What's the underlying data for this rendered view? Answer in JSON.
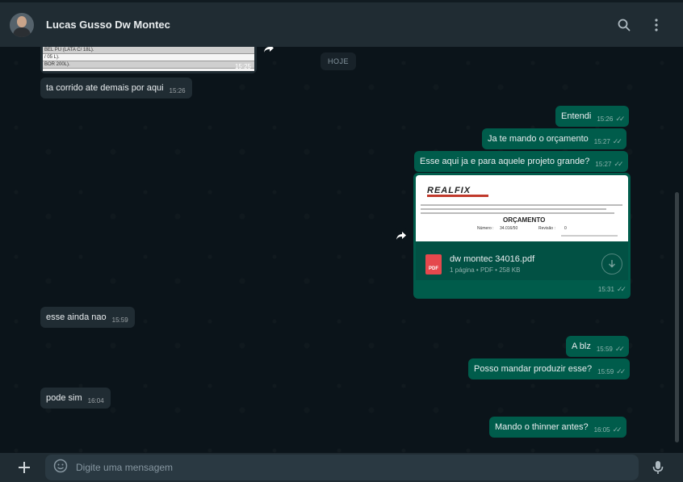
{
  "header": {
    "contact_name": "Lucas Gusso Dw Montec",
    "search_icon": "search-icon",
    "menu_icon": "kebab-menu-icon"
  },
  "chat": {
    "day_chip": "HOJE",
    "image_fragment": {
      "rows": [
        "BEL PU (LATA C/ 18L).",
        "/ 05 L).",
        "BOR 200L)."
      ],
      "time": "15:25"
    },
    "messages": [
      {
        "id": "m1",
        "direction": "in",
        "text": "ta corrido ate demais por aqui",
        "time": "15:26"
      },
      {
        "id": "m2",
        "direction": "out",
        "text": "Entendi",
        "time": "15:26"
      },
      {
        "id": "m3",
        "direction": "out",
        "text": "Ja te mando o orçamento",
        "time": "15:27"
      },
      {
        "id": "m4",
        "direction": "out",
        "text": "Esse aqui ja e para aquele projeto grande?",
        "time": "15:27"
      },
      {
        "id": "m6",
        "direction": "in",
        "text": "esse ainda nao",
        "time": "15:59"
      },
      {
        "id": "m7",
        "direction": "out",
        "text": "A blz",
        "time": "15:59"
      },
      {
        "id": "m8",
        "direction": "out",
        "text": "Posso mandar produzir esse?",
        "time": "15:59"
      },
      {
        "id": "m9",
        "direction": "in",
        "text": "pode sim",
        "time": "16:04"
      },
      {
        "id": "m10",
        "direction": "out",
        "text": "Mando o thinner antes?",
        "time": "16:05"
      }
    ],
    "document": {
      "preview_logo": "REALFIX",
      "preview_title": "ORÇAMENTO",
      "preview_number_label": "Número :",
      "preview_number": "34.016/50",
      "preview_revision_label": "Revisão :",
      "preview_revision": "0",
      "file_name": "dw montec 34016.pdf",
      "file_meta": "1 página • PDF • 258 KB",
      "pdf_badge": "PDF",
      "time": "15:31"
    },
    "read_ticks": "✓✓"
  },
  "composer": {
    "placeholder": "Digite uma mensagem",
    "attach_icon": "plus-icon",
    "emoji_icon": "sticker-icon",
    "mic_icon": "microphone-icon"
  }
}
